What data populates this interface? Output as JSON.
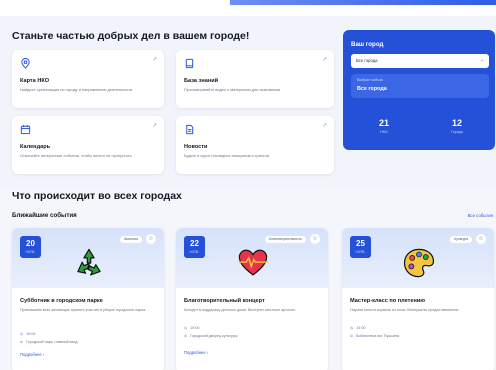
{
  "colors": {
    "accent": "#2451d8",
    "link": "#2c5ae0",
    "background": "#f4f6fb"
  },
  "hero": {
    "title": "Станьте частью добрых дел в вашем городе!",
    "cards": [
      {
        "icon": "map-pin-icon",
        "title": "Карта НКО",
        "description": "Найдите организации по городу и направлению деятельности"
      },
      {
        "icon": "book-icon",
        "title": "База знаний",
        "description": "Просматривайте видео и материалы для скачивания"
      },
      {
        "icon": "calendar-icon",
        "title": "Календарь",
        "description": "Отмечайте интересные события, чтобы ничего не пропустить"
      },
      {
        "icon": "document-icon",
        "title": "Новости",
        "description": "Будьте в курсе последних инициатив и грантов"
      }
    ]
  },
  "city_panel": {
    "title": "Ваш город",
    "select_value": "Все города",
    "chosen_label": "Выбран сейчас",
    "chosen_value": "Все города",
    "stats": [
      {
        "value": "21",
        "label": "НКО"
      },
      {
        "value": "12",
        "label": "Города"
      }
    ]
  },
  "events_section": {
    "title": "Что происходит во всех городах",
    "subtitle": "Ближайшие события",
    "all_link": "Все события",
    "events": [
      {
        "day": "20",
        "month": "НОЯБ.",
        "tag": "Экология",
        "icon": "recycle-icon",
        "title": "Субботник в городском парке",
        "description": "Приглашаем всех желающих принять участие в уборке городского парка.",
        "time": "10:00",
        "place": "Городской парк, главный вход",
        "more": "Подробнее"
      },
      {
        "day": "22",
        "month": "НОЯБ.",
        "tag": "Благотворительность",
        "icon": "heart-icon",
        "title": "Благотворительный концерт",
        "description": "Концерт в поддержку детского дома. Выступят местные артисты.",
        "time": "19:00",
        "place": "Городской дворец культуры",
        "more": "Подробнее"
      },
      {
        "day": "25",
        "month": "НОЯБ.",
        "tag": "Культура",
        "icon": "palette-icon",
        "title": "Мастер-класс по плетению",
        "description": "Научим плести корзины из лозы. Материалы предоставляются.",
        "time": "14:00",
        "place": "Библиотека им. Пушкина",
        "more": "Подробнее"
      }
    ]
  }
}
